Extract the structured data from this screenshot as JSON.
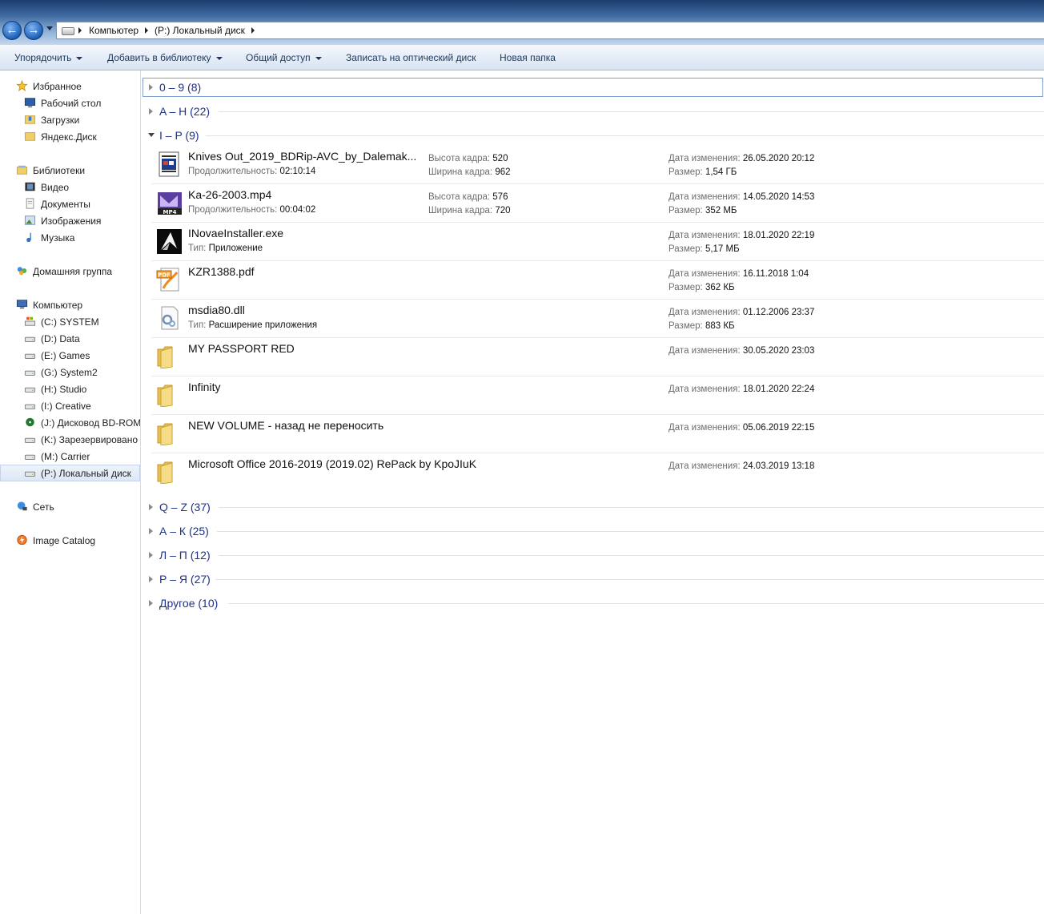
{
  "address": {
    "crumbs": [
      "Компьютер",
      "(P:) Локальный диск"
    ]
  },
  "toolbar": {
    "organize": "Упорядочить",
    "add_library": "Добавить в библиотеку",
    "share": "Общий доступ",
    "burn": "Записать на оптический диск",
    "new_folder": "Новая папка"
  },
  "nav": {
    "favorites": "Избранное",
    "desktop": "Рабочий стол",
    "downloads": "Загрузки",
    "yandex": "Яндекс.Диск",
    "libraries": "Библиотеки",
    "video": "Видео",
    "documents": "Документы",
    "images": "Изображения",
    "music": "Музыка",
    "homegroup": "Домашняя группа",
    "computer": "Компьютер",
    "drives": [
      "(C:) SYSTEM",
      "(D:) Data",
      "(E:) Games",
      "(G:) System2",
      "(H:) Studio",
      "(I:) Creative",
      "(J:) Дисковод BD-ROM",
      "(K:) Зарезервировано с",
      "(M:) Carrier",
      "(P:) Локальный диск"
    ],
    "network": "Сеть",
    "image_catalog": "Image Catalog"
  },
  "labels": {
    "frame_height": "Высота кадра:",
    "frame_width": "Ширина кадра:",
    "duration": "Продолжительность:",
    "type": "Тип:",
    "modified": "Дата изменения:",
    "size": "Размер:"
  },
  "groups_top": [
    "0 – 9 (8)",
    "A – H (22)",
    "I – P (9)"
  ],
  "groups_bottom": [
    "Q – Z (37)",
    "А – К (25)",
    "Л – П (12)",
    "Р – Я (27)",
    "Другое (10)"
  ],
  "files": [
    {
      "name": "Knives Out_2019_BDRip-AVC_by_Dalemak...",
      "duration": "02:10:14",
      "frame_height": "520",
      "frame_width": "962",
      "modified": "26.05.2020 20:12",
      "size": "1,54 ГБ"
    },
    {
      "name": "Ka-26-2003.mp4",
      "duration": "00:04:02",
      "frame_height": "576",
      "frame_width": "720",
      "modified": "14.05.2020 14:53",
      "size": "352 МБ",
      "icon_text": "MP4"
    },
    {
      "name": "INovaeInstaller.exe",
      "type": "Приложение",
      "modified": "18.01.2020 22:19",
      "size": "5,17 МБ"
    },
    {
      "name": "KZR1388.pdf",
      "modified": "16.11.2018 1:04",
      "size": "362 КБ",
      "icon_text": "PDF"
    },
    {
      "name": "msdia80.dll",
      "type": "Расширение приложения",
      "modified": "01.12.2006 23:37",
      "size": "883 КБ"
    },
    {
      "name": "MY PASSPORT RED",
      "modified": "30.05.2020 23:03"
    },
    {
      "name": "Infinity",
      "modified": "18.01.2020 22:24"
    },
    {
      "name": "NEW VOLUME - назад не переносить",
      "modified": "05.06.2019 22:15"
    },
    {
      "name": "Microsoft Office 2016-2019 (2019.02) RePack by KpoJIuK",
      "modified": "24.03.2019 13:18"
    }
  ]
}
